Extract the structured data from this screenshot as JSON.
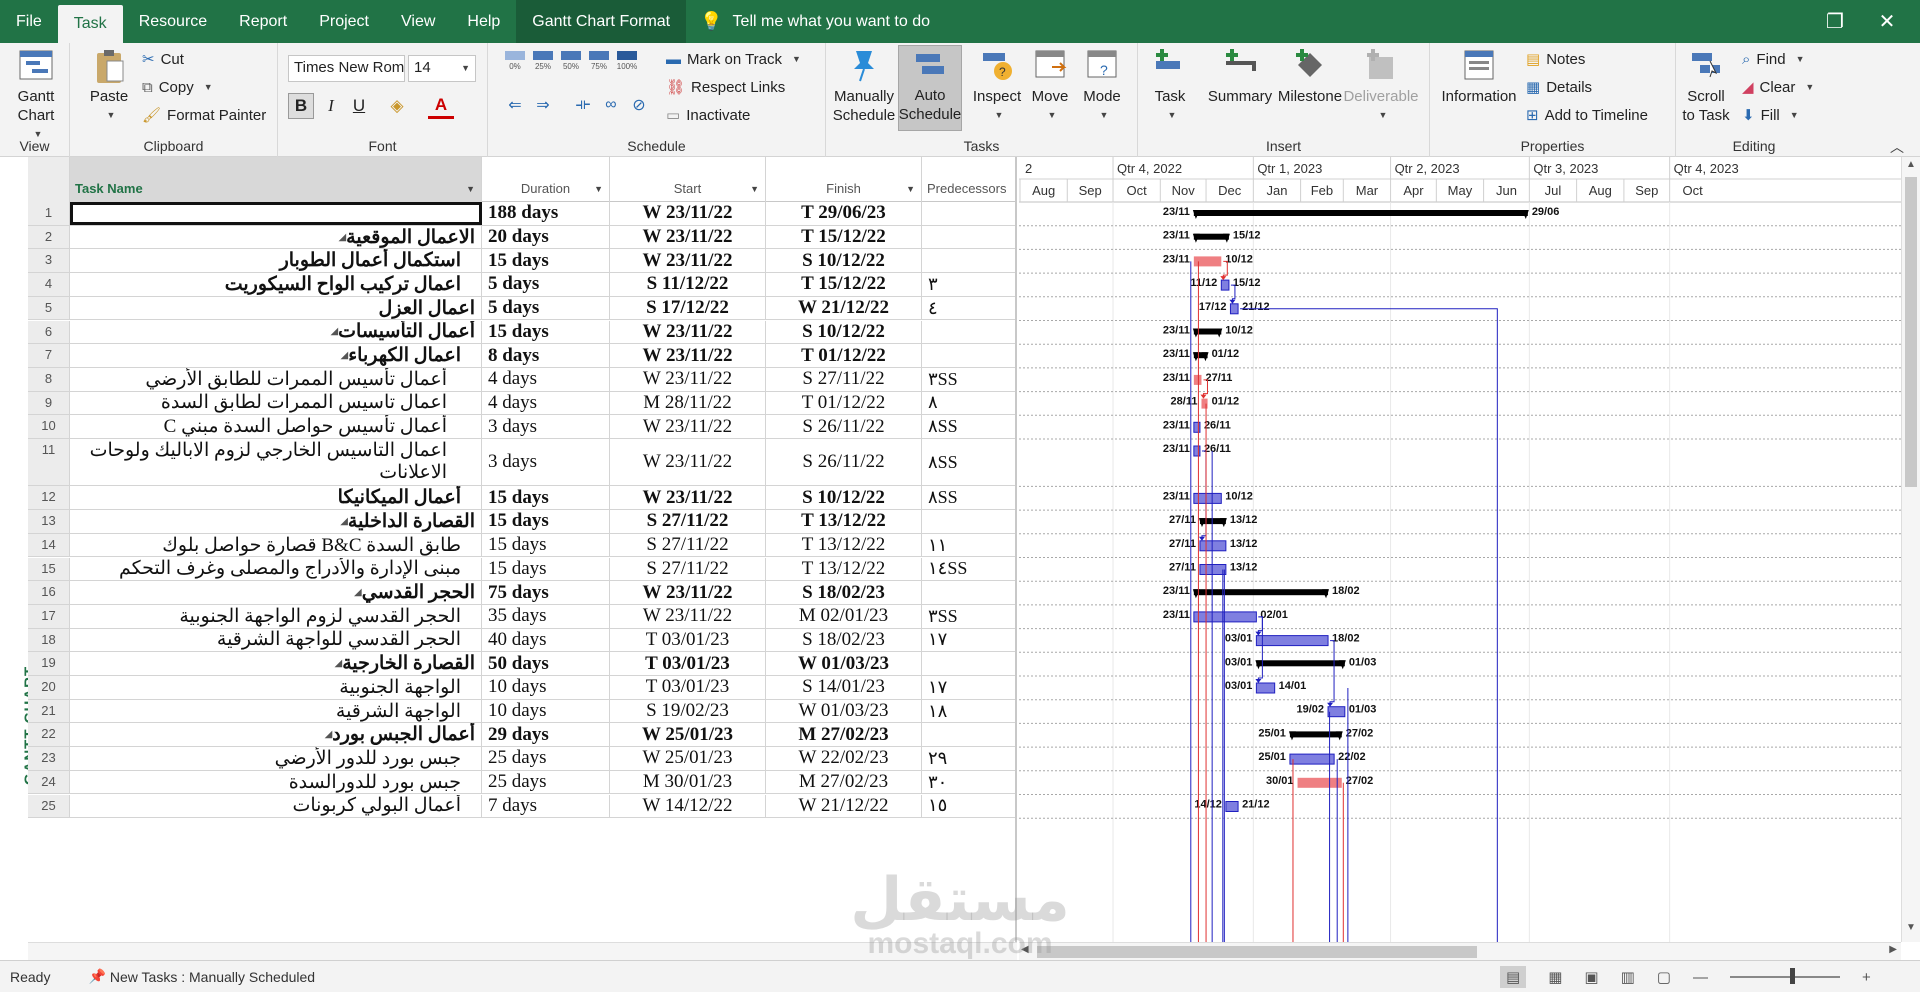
{
  "menubar": {
    "tabs": [
      "File",
      "Task",
      "Resource",
      "Report",
      "Project",
      "View",
      "Help",
      "Gantt Chart Format"
    ],
    "active_tab": "Task",
    "tell_me": "Tell me what you want to do"
  },
  "ribbon": {
    "view": {
      "group": "View",
      "gantt_chart": "Gantt Chart"
    },
    "clipboard": {
      "group": "Clipboard",
      "paste": "Paste",
      "cut": "Cut",
      "copy": "Copy",
      "format_painter": "Format Painter"
    },
    "font": {
      "group": "Font",
      "family": "Times New Roman",
      "size": "14",
      "bold": "B",
      "italic": "I",
      "underline": "U"
    },
    "schedule": {
      "group": "Schedule",
      "pct": [
        "0%",
        "25%",
        "50%",
        "75%",
        "100%"
      ],
      "mark_on_track": "Mark on Track",
      "respect_links": "Respect Links",
      "inactivate": "Inactivate"
    },
    "tasks": {
      "group": "Tasks",
      "manually_schedule": "Manually Schedule",
      "auto_schedule": "Auto Schedule",
      "inspect": "Inspect",
      "move": "Move",
      "mode": "Mode"
    },
    "insert": {
      "group": "Insert",
      "task": "Task",
      "summary": "Summary",
      "milestone": "Milestone",
      "deliverable": "Deliverable"
    },
    "properties": {
      "group": "Properties",
      "information": "Information",
      "notes": "Notes",
      "details": "Details",
      "add_to_timeline": "Add to Timeline"
    },
    "editing": {
      "group": "Editing",
      "scroll_to_task": "Scroll to Task",
      "find": "Find",
      "clear": "Clear",
      "fill": "Fill"
    }
  },
  "side_label": "GANTT CHART",
  "table": {
    "headers": {
      "name": "Task Name",
      "duration": "Duration",
      "start": "Start",
      "finish": "Finish",
      "predecessors": "Predecessors"
    },
    "rows": [
      {
        "id": "1",
        "name": "",
        "dur": "188 days",
        "start": "W 23/11/22",
        "fin": "T 29/06/23",
        "pred": "",
        "bold": true,
        "indent": 0,
        "summary": false,
        "selected": true
      },
      {
        "id": "2",
        "name": "الاعمال الموقعية",
        "dur": "20 days",
        "start": "W 23/11/22",
        "fin": "T 15/12/22",
        "pred": "",
        "bold": true,
        "indent": 0,
        "summary": true
      },
      {
        "id": "3",
        "name": "استكمال أعمال الطوبار",
        "dur": "15 days",
        "start": "W 23/11/22",
        "fin": "S 10/12/22",
        "pred": "",
        "bold": true,
        "indent": 1,
        "summary": false
      },
      {
        "id": "4",
        "name": "اعمال تركيب الواح السيكوريت",
        "dur": "5 days",
        "start": "S 11/12/22",
        "fin": "T 15/12/22",
        "pred": "٣",
        "bold": true,
        "indent": 1,
        "summary": false
      },
      {
        "id": "5",
        "name": "اعمال العزل",
        "dur": "5 days",
        "start": "S 17/12/22",
        "fin": "W 21/12/22",
        "pred": "٤",
        "bold": true,
        "indent": 0,
        "summary": false
      },
      {
        "id": "6",
        "name": "أعمال التأسيسات",
        "dur": "15 days",
        "start": "W 23/11/22",
        "fin": "S 10/12/22",
        "pred": "",
        "bold": true,
        "indent": 0,
        "summary": true
      },
      {
        "id": "7",
        "name": "اعمال الكهرباء",
        "dur": "8 days",
        "start": "W 23/11/22",
        "fin": "T 01/12/22",
        "pred": "",
        "bold": true,
        "indent": 1,
        "summary": true
      },
      {
        "id": "8",
        "name": "أعمال تأسيس الممرات للطابق الأرضي",
        "dur": "4 days",
        "start": "W 23/11/22",
        "fin": "S 27/11/22",
        "pred": "٣SS",
        "bold": false,
        "indent": 2,
        "summary": false
      },
      {
        "id": "9",
        "name": "اعمال تاسيس الممرات لطابق السدة",
        "dur": "4 days",
        "start": "M 28/11/22",
        "fin": "T 01/12/22",
        "pred": "٨",
        "bold": false,
        "indent": 2,
        "summary": false
      },
      {
        "id": "10",
        "name": "أعمال تأسيس حواصل السدة مبني C",
        "dur": "3 days",
        "start": "W 23/11/22",
        "fin": "S 26/11/22",
        "pred": "٨SS",
        "bold": false,
        "indent": 2,
        "summary": false
      },
      {
        "id": "11",
        "name": "اعمال التاسيس الخارجي لزوم الاباليك ولوحات",
        "name2": "الاعلانات",
        "dur": "3 days",
        "start": "W 23/11/22",
        "fin": "S 26/11/22",
        "pred": "٨SS",
        "bold": false,
        "indent": 2,
        "summary": false,
        "tall": true
      },
      {
        "id": "12",
        "name": "أعمال الميكانيكا",
        "dur": "15 days",
        "start": "W 23/11/22",
        "fin": "S 10/12/22",
        "pred": "٨SS",
        "bold": true,
        "indent": 1,
        "summary": false
      },
      {
        "id": "13",
        "name": "القصارة الداخلية",
        "dur": "15 days",
        "start": "S 27/11/22",
        "fin": "T 13/12/22",
        "pred": "",
        "bold": true,
        "indent": 0,
        "summary": true
      },
      {
        "id": "14",
        "name": "طابق السدة B&C قصارة حواصل بلوك",
        "dur": "15 days",
        "start": "S 27/11/22",
        "fin": "T 13/12/22",
        "pred": "١١",
        "bold": false,
        "indent": 1,
        "summary": false
      },
      {
        "id": "15",
        "name": "مبنى الإدارة والأدراج والمصلى وغرف التحكم",
        "dur": "15 days",
        "start": "S 27/11/22",
        "fin": "T 13/12/22",
        "pred": "١٤SS",
        "bold": false,
        "indent": 1,
        "summary": false
      },
      {
        "id": "16",
        "name": "الحجر القدسي",
        "dur": "75 days",
        "start": "W 23/11/22",
        "fin": "S 18/02/23",
        "pred": "",
        "bold": true,
        "indent": 0,
        "summary": true
      },
      {
        "id": "17",
        "name": "الحجر القدسي لزوم الواجهة الجنوبية",
        "dur": "35 days",
        "start": "W 23/11/22",
        "fin": "M 02/01/23",
        "pred": "٣SS",
        "bold": false,
        "indent": 1,
        "summary": false
      },
      {
        "id": "18",
        "name": "الحجر القدسي للواجهة الشرقية",
        "dur": "40 days",
        "start": "T 03/01/23",
        "fin": "S 18/02/23",
        "pred": "١٧",
        "bold": false,
        "indent": 1,
        "summary": false
      },
      {
        "id": "19",
        "name": "القصارة الخارجية",
        "dur": "50 days",
        "start": "T 03/01/23",
        "fin": "W 01/03/23",
        "pred": "",
        "bold": true,
        "indent": 0,
        "summary": true
      },
      {
        "id": "20",
        "name": "الواجهة الجنوبية",
        "dur": "10 days",
        "start": "T 03/01/23",
        "fin": "S 14/01/23",
        "pred": "١٧",
        "bold": false,
        "indent": 1,
        "summary": false
      },
      {
        "id": "21",
        "name": "الواجهة الشرقية",
        "dur": "10 days",
        "start": "S 19/02/23",
        "fin": "W 01/03/23",
        "pred": "١٨",
        "bold": false,
        "indent": 1,
        "summary": false
      },
      {
        "id": "22",
        "name": "أعمال الجبس بورد",
        "dur": "29 days",
        "start": "W 25/01/23",
        "fin": "M 27/02/23",
        "pred": "",
        "bold": true,
        "indent": 0,
        "summary": true
      },
      {
        "id": "23",
        "name": "جبس بورد للدور الأرضي",
        "dur": "25 days",
        "start": "W 25/01/23",
        "fin": "W 22/02/23",
        "pred": "٢٩",
        "bold": false,
        "indent": 1,
        "summary": false
      },
      {
        "id": "24",
        "name": "جبس بورد للدورالسدة",
        "dur": "25 days",
        "start": "M 30/01/23",
        "fin": "M 27/02/23",
        "pred": "٣٠",
        "bold": false,
        "indent": 1,
        "summary": false
      },
      {
        "id": "25",
        "name": "أعمال البولي كربونات",
        "dur": "7 days",
        "start": "W 14/12/22",
        "fin": "W 21/12/22",
        "pred": "١٥",
        "bold": false,
        "indent": 1,
        "summary": false
      }
    ]
  },
  "timescale": {
    "quarters": [
      {
        "label": "2",
        "date": "2022-09-15"
      },
      {
        "label": "Qtr 4, 2022",
        "date": "2022-10-01"
      },
      {
        "label": "Qtr 1, 2023",
        "date": "2023-01-01"
      },
      {
        "label": "Qtr 2, 2023",
        "date": "2023-04-01"
      },
      {
        "label": "Qtr 3, 2023",
        "date": "2023-07-01"
      },
      {
        "label": "Qtr 4, 2023",
        "date": "2023-10-01"
      }
    ],
    "months": [
      {
        "label": "Aug",
        "date": "2022-08-01"
      },
      {
        "label": "Sep",
        "date": "2022-09-01"
      },
      {
        "label": "Oct",
        "date": "2022-10-01"
      },
      {
        "label": "Nov",
        "date": "2022-11-01"
      },
      {
        "label": "Dec",
        "date": "2022-12-01"
      },
      {
        "label": "Jan",
        "date": "2023-01-01"
      },
      {
        "label": "Feb",
        "date": "2023-02-01"
      },
      {
        "label": "Mar",
        "date": "2023-03-01"
      },
      {
        "label": "Apr",
        "date": "2023-04-01"
      },
      {
        "label": "May",
        "date": "2023-05-01"
      },
      {
        "label": "Jun",
        "date": "2023-06-01"
      },
      {
        "label": "Jul",
        "date": "2023-07-01"
      },
      {
        "label": "Aug",
        "date": "2023-08-01"
      },
      {
        "label": "Sep",
        "date": "2023-09-01"
      },
      {
        "label": "Oct",
        "date": "2023-10-01"
      }
    ],
    "range_start": "2022-08-01"
  },
  "bars": [
    {
      "row": 1,
      "start": "2022-11-23",
      "end": "2023-06-29",
      "type": "summary",
      "lstart": "23/11",
      "lend": "29/06"
    },
    {
      "row": 2,
      "start": "2022-11-23",
      "end": "2022-12-15",
      "type": "summary",
      "lstart": "23/11",
      "lend": "15/12"
    },
    {
      "row": 3,
      "start": "2022-11-23",
      "end": "2022-12-10",
      "type": "critical",
      "lstart": "23/11",
      "lend": "10/12"
    },
    {
      "row": 4,
      "start": "2022-12-11",
      "end": "2022-12-15",
      "type": "task",
      "lstart": "11/12",
      "lend": "15/12"
    },
    {
      "row": 5,
      "start": "2022-12-17",
      "end": "2022-12-21",
      "type": "task",
      "lstart": "17/12",
      "lend": "21/12"
    },
    {
      "row": 6,
      "start": "2022-11-23",
      "end": "2022-12-10",
      "type": "summary",
      "lstart": "23/11",
      "lend": "10/12"
    },
    {
      "row": 7,
      "start": "2022-11-23",
      "end": "2022-12-01",
      "type": "summary",
      "lstart": "23/11",
      "lend": "01/12"
    },
    {
      "row": 8,
      "start": "2022-11-23",
      "end": "2022-11-27",
      "type": "critical",
      "lstart": "23/11",
      "lend": "27/11"
    },
    {
      "row": 9,
      "start": "2022-11-28",
      "end": "2022-12-01",
      "type": "critical",
      "lstart": "28/11",
      "lend": "01/12"
    },
    {
      "row": 10,
      "start": "2022-11-23",
      "end": "2022-11-26",
      "type": "task",
      "lstart": "23/11",
      "lend": "26/11"
    },
    {
      "row": 11,
      "start": "2022-11-23",
      "end": "2022-11-26",
      "type": "task",
      "lstart": "23/11",
      "lend": "26/11"
    },
    {
      "row": 12,
      "start": "2022-11-23",
      "end": "2022-12-10",
      "type": "task",
      "lstart": "23/11",
      "lend": "10/12"
    },
    {
      "row": 13,
      "start": "2022-11-27",
      "end": "2022-12-13",
      "type": "summary",
      "lstart": "27/11",
      "lend": "13/12"
    },
    {
      "row": 14,
      "start": "2022-11-27",
      "end": "2022-12-13",
      "type": "task",
      "lstart": "27/11",
      "lend": "13/12"
    },
    {
      "row": 15,
      "start": "2022-11-27",
      "end": "2022-12-13",
      "type": "task",
      "lstart": "27/11",
      "lend": "13/12"
    },
    {
      "row": 16,
      "start": "2022-11-23",
      "end": "2023-02-18",
      "type": "summary",
      "lstart": "23/11",
      "lend": "18/02"
    },
    {
      "row": 17,
      "start": "2022-11-23",
      "end": "2023-01-02",
      "type": "task",
      "lstart": "23/11",
      "lend": "02/01"
    },
    {
      "row": 18,
      "start": "2023-01-03",
      "end": "2023-02-18",
      "type": "task",
      "lstart": "03/01",
      "lend": "18/02"
    },
    {
      "row": 19,
      "start": "2023-01-03",
      "end": "2023-03-01",
      "type": "summary",
      "lstart": "03/01",
      "lend": "01/03"
    },
    {
      "row": 20,
      "start": "2023-01-03",
      "end": "2023-01-14",
      "type": "task",
      "lstart": "03/01",
      "lend": "14/01"
    },
    {
      "row": 21,
      "start": "2023-02-19",
      "end": "2023-03-01",
      "type": "task",
      "lstart": "19/02",
      "lend": "01/03"
    },
    {
      "row": 22,
      "start": "2023-01-25",
      "end": "2023-02-27",
      "type": "summary",
      "lstart": "25/01",
      "lend": "27/02"
    },
    {
      "row": 23,
      "start": "2023-01-25",
      "end": "2023-02-22",
      "type": "task",
      "lstart": "25/01",
      "lend": "22/02"
    },
    {
      "row": 24,
      "start": "2023-01-30",
      "end": "2023-02-27",
      "type": "critical",
      "lstart": "30/01",
      "lend": "27/02"
    },
    {
      "row": 25,
      "start": "2022-12-14",
      "end": "2022-12-21",
      "type": "task",
      "lstart": "14/12",
      "lend": "21/12"
    }
  ],
  "colors": {
    "ribbon_green": "#217346",
    "task_bar": "#7f7fe0",
    "task_border": "#2020c0",
    "critical_bar": "#ef7f82",
    "critical_line": "#e03030",
    "link_line": "#2020c0",
    "summary": "#000000"
  },
  "status": {
    "ready": "Ready",
    "new_tasks": "New Tasks : Manually Scheduled"
  },
  "watermark": {
    "text": "مستقل",
    "sub": "mostaql.com"
  }
}
